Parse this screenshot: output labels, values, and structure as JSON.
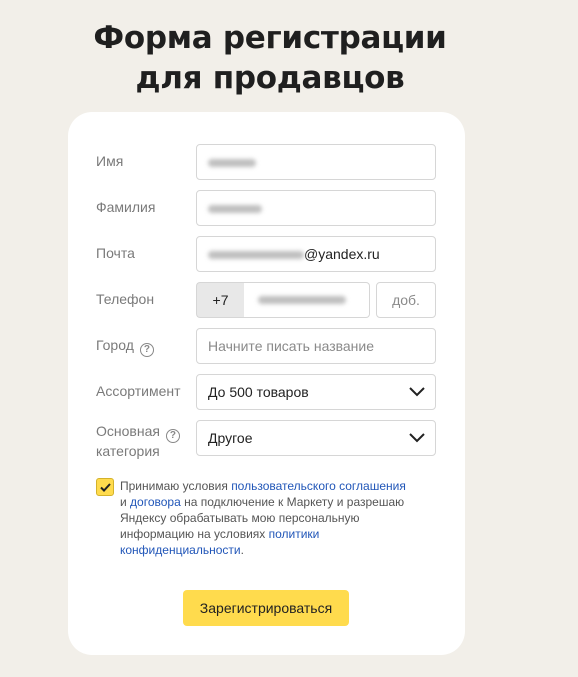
{
  "page": {
    "title_line1": "Форма регистрации",
    "title_line2": "для продавцов"
  },
  "form": {
    "first_name": {
      "label": "Имя",
      "value": "роман"
    },
    "last_name": {
      "label": "Фамилия",
      "value": "тарасов"
    },
    "email": {
      "label": "Почта",
      "value_local": "romanq.tarasov",
      "value_domain": "@yandex.ru"
    },
    "phone": {
      "label": "Телефон",
      "prefix": "+7",
      "value": "911 281 06 21",
      "ext_placeholder": "доб."
    },
    "city": {
      "label": "Город",
      "placeholder": "Начните писать название",
      "help_icon": "question-circle-icon"
    },
    "assortment": {
      "label": "Ассортимент",
      "value": "До 500 товаров",
      "icon": "chevron-down-icon"
    },
    "category": {
      "label_line1": "Основная",
      "label_line2": "категория",
      "value": "Другое",
      "help_icon": "question-circle-icon",
      "icon": "chevron-down-icon"
    }
  },
  "consent": {
    "checked": true,
    "text_1": "Принимаю условия ",
    "link_1": "пользовательского соглашения",
    "text_2": "и ",
    "link_2": "договора",
    "text_3": " на подключение к Маркету и разрешаю Яндексу обрабатывать мою персональную информацию на условиях ",
    "link_3": "политики конфиденциальности",
    "text_4": "."
  },
  "submit_label": "Зарегистрироваться",
  "colors": {
    "accent": "#ffdb4d",
    "link": "#2156b8",
    "background": "#f2efe9"
  }
}
